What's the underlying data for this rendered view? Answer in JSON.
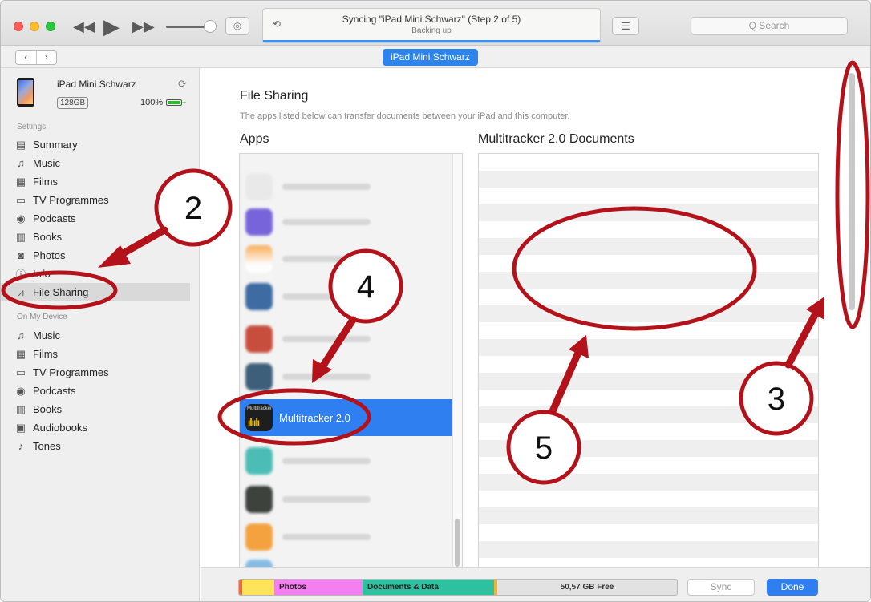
{
  "toolbar": {
    "lcd_title": "Syncing \"iPad Mini Schwarz\" (Step 2 of 5)",
    "lcd_subtitle": "Backing up",
    "search_placeholder": "Q Search"
  },
  "subbar": {
    "device_pill": "iPad Mini Schwarz"
  },
  "device": {
    "name": "iPad Mini Schwarz",
    "capacity": "128GB",
    "battery": "100%"
  },
  "sidebar": {
    "settings_header": "Settings",
    "settings_items": [
      {
        "label": "Summary",
        "icon": "summary-icon"
      },
      {
        "label": "Music",
        "icon": "music-note-icon"
      },
      {
        "label": "Films",
        "icon": "film-icon"
      },
      {
        "label": "TV Programmes",
        "icon": "tv-icon"
      },
      {
        "label": "Podcasts",
        "icon": "podcast-icon"
      },
      {
        "label": "Books",
        "icon": "books-icon"
      },
      {
        "label": "Photos",
        "icon": "camera-icon"
      },
      {
        "label": "Info",
        "icon": "info-icon"
      },
      {
        "label": "File Sharing",
        "icon": "app-store-icon",
        "selected": true
      }
    ],
    "device_header": "On My Device",
    "device_items": [
      {
        "label": "Music",
        "icon": "music-note-icon"
      },
      {
        "label": "Films",
        "icon": "film-icon"
      },
      {
        "label": "TV Programmes",
        "icon": "tv-icon"
      },
      {
        "label": "Podcasts",
        "icon": "podcast-icon"
      },
      {
        "label": "Books",
        "icon": "books-icon"
      },
      {
        "label": "Audiobooks",
        "icon": "audiobook-icon"
      },
      {
        "label": "Tones",
        "icon": "bell-icon"
      }
    ]
  },
  "main": {
    "title": "File Sharing",
    "subtitle": "The apps listed below can transfer documents between your iPad and this computer.",
    "apps_header": "Apps",
    "docs_header": "Multitracker 2.0 Documents",
    "selected_app": "Multitracker 2.0",
    "selected_app_icon_text": "Multitracker"
  },
  "capacity": {
    "photos": "Photos",
    "docs": "Documents & Data",
    "free": "50,57 GB Free"
  },
  "buttons": {
    "sync": "Sync",
    "done": "Done"
  },
  "annotations": {
    "n2": "2",
    "n3": "3",
    "n4": "4",
    "n5": "5"
  },
  "colors": {
    "accent": "#2f7ff0",
    "annotation": "#b3121a",
    "photos_segment": "#f47ff0",
    "docs_segment": "#2ec1a0",
    "other_segment": "#ffe45a"
  }
}
